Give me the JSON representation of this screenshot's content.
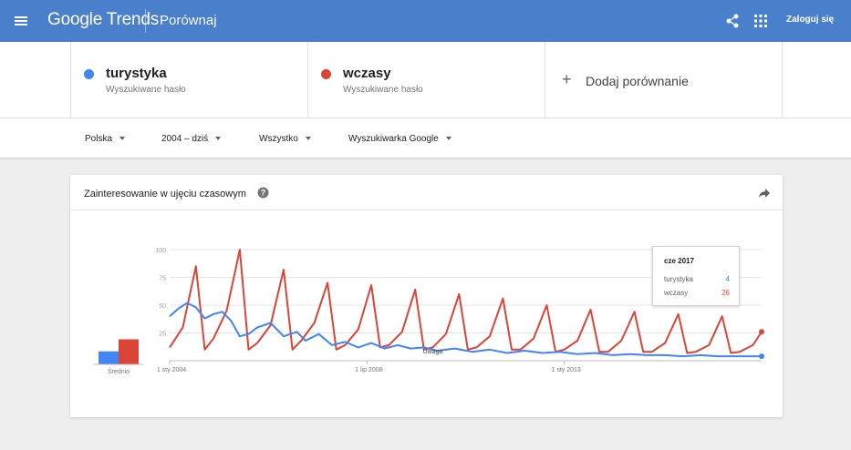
{
  "header": {
    "brand": "Google Trends",
    "page_name": "Porównaj",
    "signin_label": "Zaloguj się"
  },
  "terms": [
    {
      "name": "turystyka",
      "subtitle": "Wyszukiwane hasło",
      "color": "#4285f4"
    },
    {
      "name": "wczasy",
      "subtitle": "Wyszukiwane hasło",
      "color": "#db4437"
    }
  ],
  "add_comparison_label": "Dodaj porównanie",
  "filters": {
    "region": "Polska",
    "period": "2004 – dziś",
    "category": "Wszystko",
    "property": "Wyszukiwarka Google"
  },
  "card": {
    "title": "Zainteresowanie w ujęciu czasowym",
    "average_label": "Średnio",
    "note_label": "Uwaga"
  },
  "tooltip": {
    "date": "cze 2017",
    "rows": [
      {
        "name": "turystyka",
        "value": "4",
        "color": "#4285f4"
      },
      {
        "name": "wczasy",
        "value": "26",
        "color": "#db4437"
      }
    ]
  },
  "chart_data": {
    "type": "line",
    "x_tick_labels": [
      "1 sty 2004",
      "1 lip 2008",
      "1 sty 2013"
    ],
    "y_tick_labels": [
      "100",
      "75",
      "50",
      "25"
    ],
    "ylim": [
      0,
      100
    ],
    "grid": true,
    "averages": [
      {
        "name": "turystyka",
        "value": 13
      },
      {
        "name": "wczasy",
        "value": 25
      }
    ],
    "series": [
      {
        "name": "turystyka",
        "color": "#4285f4",
        "x": [
          2004.0,
          2004.2,
          2004.4,
          2004.6,
          2004.8,
          2005.0,
          2005.2,
          2005.4,
          2005.6,
          2005.8,
          2006.0,
          2006.3,
          2006.6,
          2006.9,
          2007.1,
          2007.4,
          2007.7,
          2008.0,
          2008.3,
          2008.6,
          2008.9,
          2009.2,
          2009.5,
          2009.8,
          2010.1,
          2010.5,
          2010.9,
          2011.3,
          2011.7,
          2012.1,
          2012.5,
          2012.9,
          2013.3,
          2013.7,
          2014.1,
          2014.5,
          2014.9,
          2015.3,
          2015.7,
          2016.1,
          2016.5,
          2016.9,
          2017.3,
          2017.5
        ],
        "values": [
          40,
          47,
          52,
          48,
          38,
          42,
          44,
          36,
          22,
          24,
          30,
          34,
          22,
          26,
          18,
          24,
          14,
          17,
          12,
          16,
          11,
          14,
          11,
          12,
          9,
          11,
          8,
          10,
          7,
          9,
          7,
          8,
          6,
          7,
          5,
          6,
          5,
          5,
          4,
          5,
          4,
          4,
          4,
          4
        ]
      },
      {
        "name": "wczasy",
        "color": "#db4437",
        "x": [
          2004.0,
          2004.3,
          2004.6,
          2004.8,
          2005.0,
          2005.3,
          2005.6,
          2005.8,
          2006.0,
          2006.3,
          2006.6,
          2006.8,
          2007.0,
          2007.3,
          2007.6,
          2007.8,
          2008.0,
          2008.3,
          2008.6,
          2008.8,
          2009.0,
          2009.3,
          2009.6,
          2009.8,
          2010.0,
          2010.3,
          2010.6,
          2010.8,
          2011.0,
          2011.3,
          2011.6,
          2011.8,
          2012.0,
          2012.3,
          2012.6,
          2012.8,
          2013.0,
          2013.3,
          2013.6,
          2013.8,
          2014.0,
          2014.3,
          2014.6,
          2014.8,
          2015.0,
          2015.3,
          2015.6,
          2015.8,
          2016.0,
          2016.3,
          2016.6,
          2016.8,
          2017.0,
          2017.3,
          2017.5
        ],
        "values": [
          12,
          30,
          85,
          10,
          20,
          45,
          100,
          10,
          16,
          32,
          82,
          10,
          18,
          34,
          70,
          10,
          14,
          28,
          68,
          12,
          14,
          26,
          64,
          10,
          12,
          24,
          60,
          10,
          12,
          22,
          56,
          10,
          10,
          20,
          50,
          8,
          10,
          18,
          46,
          8,
          8,
          18,
          44,
          8,
          8,
          16,
          42,
          7,
          8,
          14,
          40,
          7,
          8,
          14,
          26
        ]
      }
    ]
  }
}
